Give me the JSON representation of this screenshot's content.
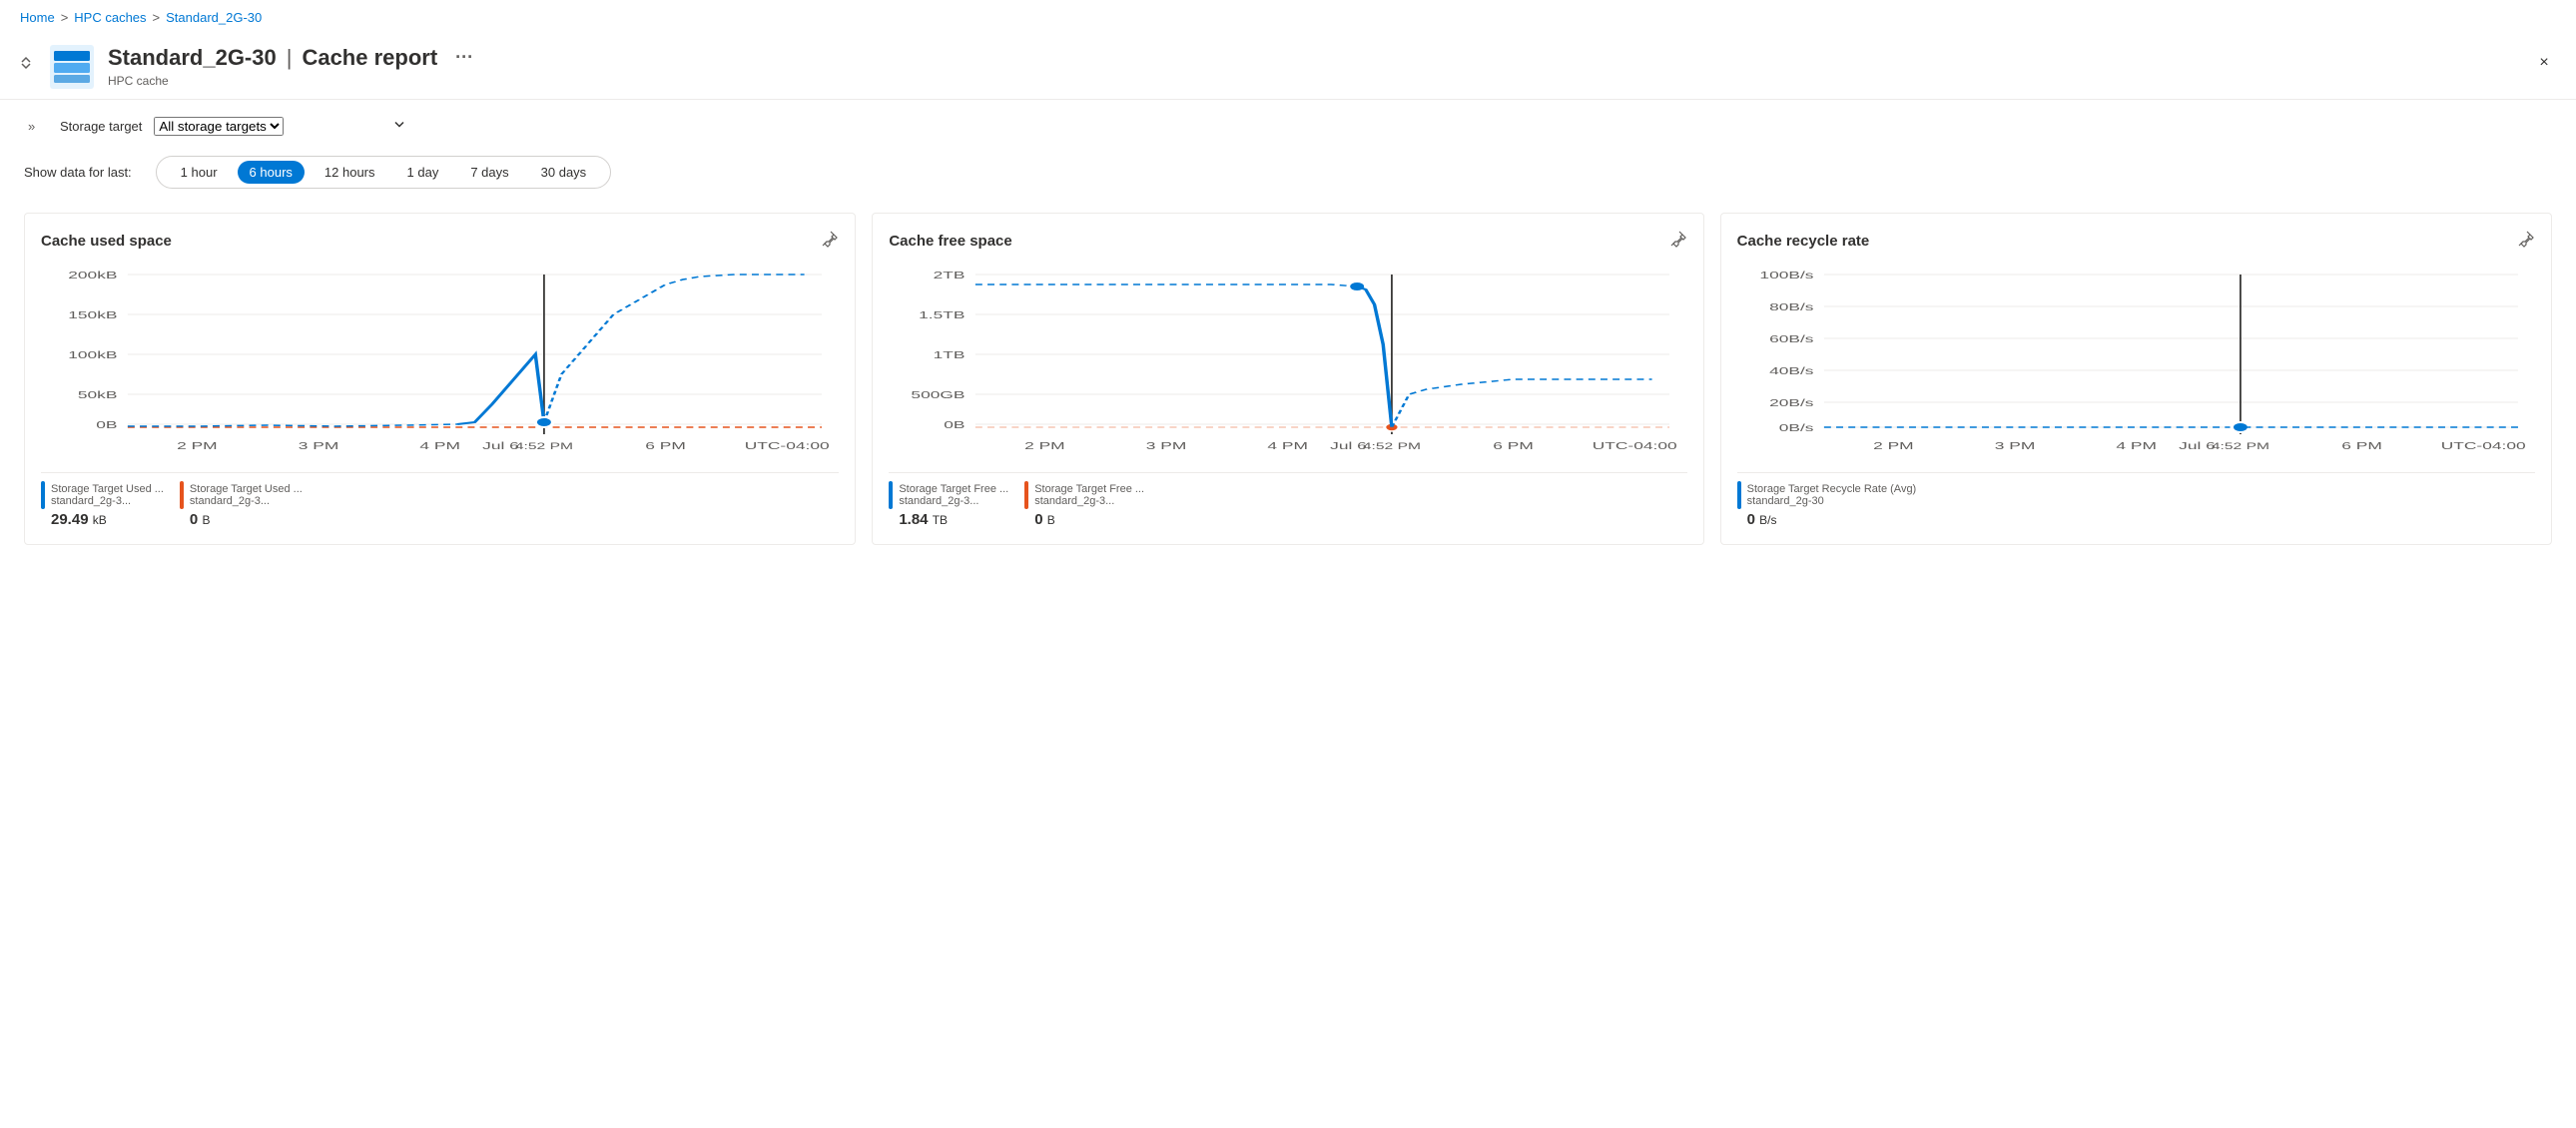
{
  "breadcrumb": {
    "items": [
      {
        "label": "Home",
        "link": true
      },
      {
        "label": "HPC caches",
        "link": true
      },
      {
        "label": "Standard_2G-30",
        "link": true
      }
    ],
    "separators": [
      ">",
      ">"
    ]
  },
  "header": {
    "title": "Standard_2G-30",
    "separator": "|",
    "subtitle_page": "Cache report",
    "resource_type": "HPC cache",
    "more_label": "···",
    "close_label": "×"
  },
  "filter": {
    "label": "Storage target",
    "dropdown_value": "All storage targets",
    "dropdown_options": [
      "All storage targets"
    ]
  },
  "time_filter": {
    "label": "Show data for last:",
    "options": [
      "1 hour",
      "6 hours",
      "12 hours",
      "1 day",
      "7 days",
      "30 days"
    ],
    "active": "6 hours"
  },
  "charts": [
    {
      "id": "cache-used-space",
      "title": "Cache used space",
      "y_labels": [
        "200kB",
        "150kB",
        "100kB",
        "50kB",
        "0B"
      ],
      "x_labels": [
        "2 PM",
        "3 PM",
        "4 PM",
        "Jul 6",
        "4:52 PM",
        "6 PM",
        "UTC-04:00"
      ],
      "legend": [
        {
          "color": "#0078d4",
          "name": "Storage Target Used ...",
          "subname": "standard_2g-3...",
          "value": "29.49",
          "unit": "kB"
        },
        {
          "color": "#e6531d",
          "name": "Storage Target Used ...",
          "subname": "standard_2g-3...",
          "value": "0",
          "unit": "B"
        }
      ]
    },
    {
      "id": "cache-free-space",
      "title": "Cache free space",
      "y_labels": [
        "2TB",
        "1.5TB",
        "1TB",
        "500GB",
        "0B"
      ],
      "x_labels": [
        "2 PM",
        "3 PM",
        "4 PM",
        "Jul 6",
        "4:52 PM",
        "6 PM",
        "UTC-04:00"
      ],
      "legend": [
        {
          "color": "#0078d4",
          "name": "Storage Target Free ...",
          "subname": "standard_2g-3...",
          "value": "1.84",
          "unit": "TB"
        },
        {
          "color": "#e6531d",
          "name": "Storage Target Free ...",
          "subname": "standard_2g-3...",
          "value": "0",
          "unit": "B"
        }
      ]
    },
    {
      "id": "cache-recycle-rate",
      "title": "Cache recycle rate",
      "y_labels": [
        "100B/s",
        "80B/s",
        "60B/s",
        "40B/s",
        "20B/s",
        "0B/s"
      ],
      "x_labels": [
        "2 PM",
        "3 PM",
        "4 PM",
        "Jul 6",
        "4:52 PM",
        "6 PM",
        "UTC-04:00"
      ],
      "legend": [
        {
          "color": "#0078d4",
          "name": "Storage Target Recycle Rate (Avg)",
          "subname": "standard_2g-30",
          "value": "0",
          "unit": "B/s"
        }
      ]
    }
  ]
}
